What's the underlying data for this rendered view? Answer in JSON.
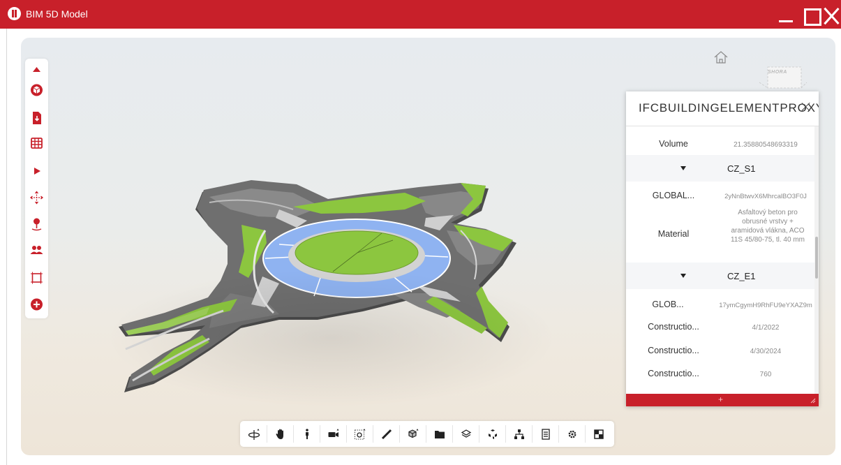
{
  "app": {
    "title": "BIM 5D Model"
  },
  "colors": {
    "brand": "#c8202a",
    "toolbar_icon": "#c8202a",
    "road_surface": "#707070",
    "grass": "#8bc34a",
    "roundabout_ring": "#8fb2f0"
  },
  "side_toolbar": {
    "items": [
      {
        "icon": "triangle-up-icon"
      },
      {
        "icon": "cube-icon"
      },
      {
        "icon": "file-download-icon"
      },
      {
        "icon": "table-icon"
      },
      {
        "icon": "play-icon"
      },
      {
        "icon": "move-arrows-icon"
      },
      {
        "icon": "map-pin-icon"
      },
      {
        "icon": "users-icon"
      },
      {
        "icon": "frame-icon"
      },
      {
        "icon": "plus-circle-icon"
      }
    ]
  },
  "viewcube": {
    "face_label": "SHORA"
  },
  "properties_panel": {
    "title": "IFCBUILDINGELEMENTPROXY",
    "rows_top": [
      {
        "name": "Volume",
        "value": "21.35880548693319"
      }
    ],
    "sections": [
      {
        "label": "CZ_S1",
        "rows": [
          {
            "name": "GLOBAL...",
            "value": "2yNnBtwvX6MhrcalBO3F0J"
          },
          {
            "name": "Material",
            "value": "Asfaltový beton pro obrusné vrstvy + aramidová vlákna, ACO 11S 45/80-75, tl. 40 mm"
          }
        ]
      },
      {
        "label": "CZ_E1",
        "rows": [
          {
            "name": "GLOB...",
            "value": "17ymCgymH9RhFU9eYXAZ9m"
          },
          {
            "name": "Constructio...",
            "value": "4/1/2022"
          },
          {
            "name": "Constructio...",
            "value": "4/30/2024"
          },
          {
            "name": "Constructio...",
            "value": "760"
          }
        ]
      }
    ],
    "footer_plus": "+"
  },
  "bottom_toolbar": {
    "items": [
      {
        "icon": "orbit-icon"
      },
      {
        "icon": "pan-hand-icon"
      },
      {
        "icon": "walk-person-icon"
      },
      {
        "icon": "camera-icon"
      },
      {
        "icon": "zoom-window-icon"
      },
      {
        "icon": "measure-ruler-icon"
      },
      {
        "icon": "section-box-icon"
      },
      {
        "icon": "folder-icon"
      },
      {
        "icon": "layers-icon"
      },
      {
        "icon": "explode-model-icon"
      },
      {
        "icon": "model-tree-icon"
      },
      {
        "icon": "properties-icon"
      },
      {
        "icon": "settings-gear-icon"
      },
      {
        "icon": "fullscreen-icon"
      }
    ]
  }
}
